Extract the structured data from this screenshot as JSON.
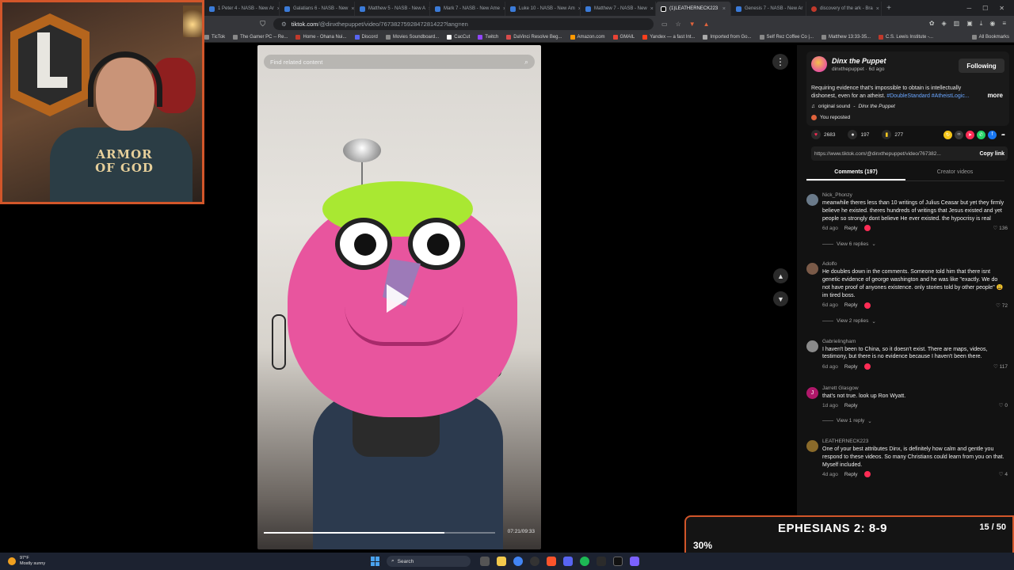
{
  "browser": {
    "tabs": [
      {
        "label": "... - New Ar"
      },
      {
        "label": "1 Peter 4 - NASB - New Ar"
      },
      {
        "label": "Galatians 6 - NASB - New"
      },
      {
        "label": "Matthew 5 - NASB - New A"
      },
      {
        "label": "Mark 7 - NASB - New Ame"
      },
      {
        "label": "Luke 10 - NASB - New Am"
      },
      {
        "label": "Matthew 7 - NASB - New"
      },
      {
        "label": "(1)LEATHERNECK223"
      },
      {
        "label": "Genesis 7 - NASB - New Ar"
      },
      {
        "label": "discovery of the ark - Bra"
      }
    ],
    "url_host": "tiktok.com",
    "url_path": "/@dinxthepuppet/video/7673827592847281422?lang=en",
    "bookmarks": [
      "TicTok",
      "The Gamer PC -- Re...",
      "Home - Ohana Nui...",
      "Discord",
      "Movies Soundboard...",
      "CacCut",
      "Twitch",
      "DaVinci Resolve Beg...",
      "Amazon.com",
      "GMAIL",
      "Yandex — a fast Int...",
      "Imported from Go...",
      "Self Rez Coffee Co |...",
      "Matthew 13:33-35...",
      "C.S. Lewis Institute -..."
    ],
    "all_bookmarks": "All Bookmarks"
  },
  "webcam": {
    "shirt_text_line1": "ARMOR",
    "shirt_text_line2": "OF GOD"
  },
  "video": {
    "search_placeholder": "Find related content",
    "timecode": "07:21/09:33",
    "progress": 0.78
  },
  "post": {
    "author_name": "Dinx the Puppet",
    "author_handle": "dinxthepuppet",
    "posted": "6d ago",
    "follow_label": "Following",
    "caption": "Requiring evidence that's impossible to obtain is intellectually dishonest, even for an atheist.",
    "hashtags": "#DoubleStandard #AtheistLogic...",
    "more_label": "more",
    "sound_label": "original sound",
    "sound_author": "Dinx the Puppet",
    "repost_label": "You reposted",
    "likes": "2683",
    "comments_count": "197",
    "saves": "277",
    "link": "https://www.tiktok.com/@dinxthepuppet/video/767382...",
    "copy_label": "Copy link",
    "tab_comments": "Comments (197)",
    "tab_creator": "Creator videos"
  },
  "comments": [
    {
      "user": "Nick_Phonzy",
      "text": "meanwhile theres less than 10 writings of Julius Ceasar but yet they firmly believe he existed. theres hundreds of writings that Jesus existed and yet people so strongly dont believe He ever existed. the hypocrisy is real",
      "age": "6d ago",
      "reply": "Reply",
      "likes": "136",
      "view_replies": "View 6 replies",
      "avatar_color": "#6a7a8a",
      "avatar_letter": ""
    },
    {
      "user": "Adolfo",
      "text": "He doubles down in the comments. Someone told him that there isnt genetic evidence of george washington and he was like \"exactly. We do not have proof of anyones existence. only stories told by other people\" 😩 im tired boss.",
      "age": "6d ago",
      "reply": "Reply",
      "likes": "72",
      "view_replies": "View 2 replies",
      "avatar_color": "#7a5a48",
      "avatar_letter": ""
    },
    {
      "user": "Gabrielingham",
      "text": "I haven't been to China, so it doesn't exist. There are maps, videos, testimony, but there is no evidence because I haven't been there.",
      "age": "6d ago",
      "reply": "Reply",
      "likes": "117",
      "view_replies": "",
      "avatar_color": "#8a8a8a",
      "avatar_letter": ""
    },
    {
      "user": "Jarrett Glasgow",
      "text": "that's not true. look up Ron Wyatt.",
      "age": "1d ago",
      "reply": "Reply",
      "likes": "0",
      "view_replies": "View 1 reply",
      "avatar_color": "#b0186a",
      "avatar_letter": "J"
    },
    {
      "user": "LEATHERNECK223",
      "text": "One of your best attributes Dinx, is definitely how calm and gentle you respond to these videos. So many Christians could learn from you on that. Myself included.",
      "age": "4d ago",
      "reply": "Reply",
      "likes": "4",
      "view_replies": "",
      "avatar_color": "#8a6a2a",
      "avatar_letter": ""
    }
  ],
  "bible_widget": {
    "title": "EPHESIANS 2: 8-9",
    "count": "15 / 50",
    "percent_label": "30%",
    "progress": 0.3
  },
  "taskbar": {
    "temp": "97°F",
    "weather": "Mostly sunny",
    "search_label": "Search"
  },
  "colors": {
    "accent_orange": "#d2562a",
    "tiktok_red": "#fe2c55",
    "hashtag_blue": "#6aa6ff",
    "progress_orange": "#e8851e"
  }
}
